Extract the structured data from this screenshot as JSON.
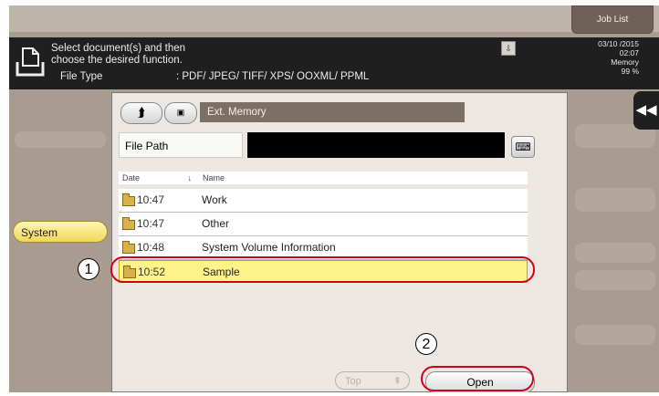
{
  "topbar": {
    "job_list": "Job List"
  },
  "message": {
    "line1": "Select document(s) and then",
    "line2": "choose the desired function.",
    "file_type_label": "File Type",
    "file_type_value": ": PDF/ JPEG/ TIFF/ XPS/ OOXML/ PPML"
  },
  "status": {
    "date": "03/10 /2015",
    "time": "02:07",
    "memory_label": "Memory",
    "memory_value": "99 %"
  },
  "sidebar": {
    "system_tab": "System"
  },
  "dialog": {
    "location": "Ext. Memory",
    "file_path_label": "File Path",
    "file_path_value": "",
    "columns": {
      "date": "Date",
      "name": "Name"
    },
    "rows": [
      {
        "time": "10:47",
        "name": "Work",
        "selected": false
      },
      {
        "time": "10:47",
        "name": "Other",
        "selected": false
      },
      {
        "time": "10:48",
        "name": "System Volume Information",
        "selected": false
      },
      {
        "time": "10:52",
        "name": "Sample",
        "selected": true
      }
    ],
    "top_button": "Top",
    "open_button": "Open"
  },
  "callouts": {
    "step1": "1",
    "step2": "2"
  },
  "colors": {
    "highlight": "#d3001c",
    "selected_row": "#fff38a",
    "system_tab": "#f0d75a"
  },
  "icons": [
    "document-icon",
    "usb-icon",
    "collapse-arrow-icon",
    "up-folder-icon",
    "memory-icon",
    "keyboard-icon",
    "folder-icon",
    "sort-down-icon"
  ]
}
